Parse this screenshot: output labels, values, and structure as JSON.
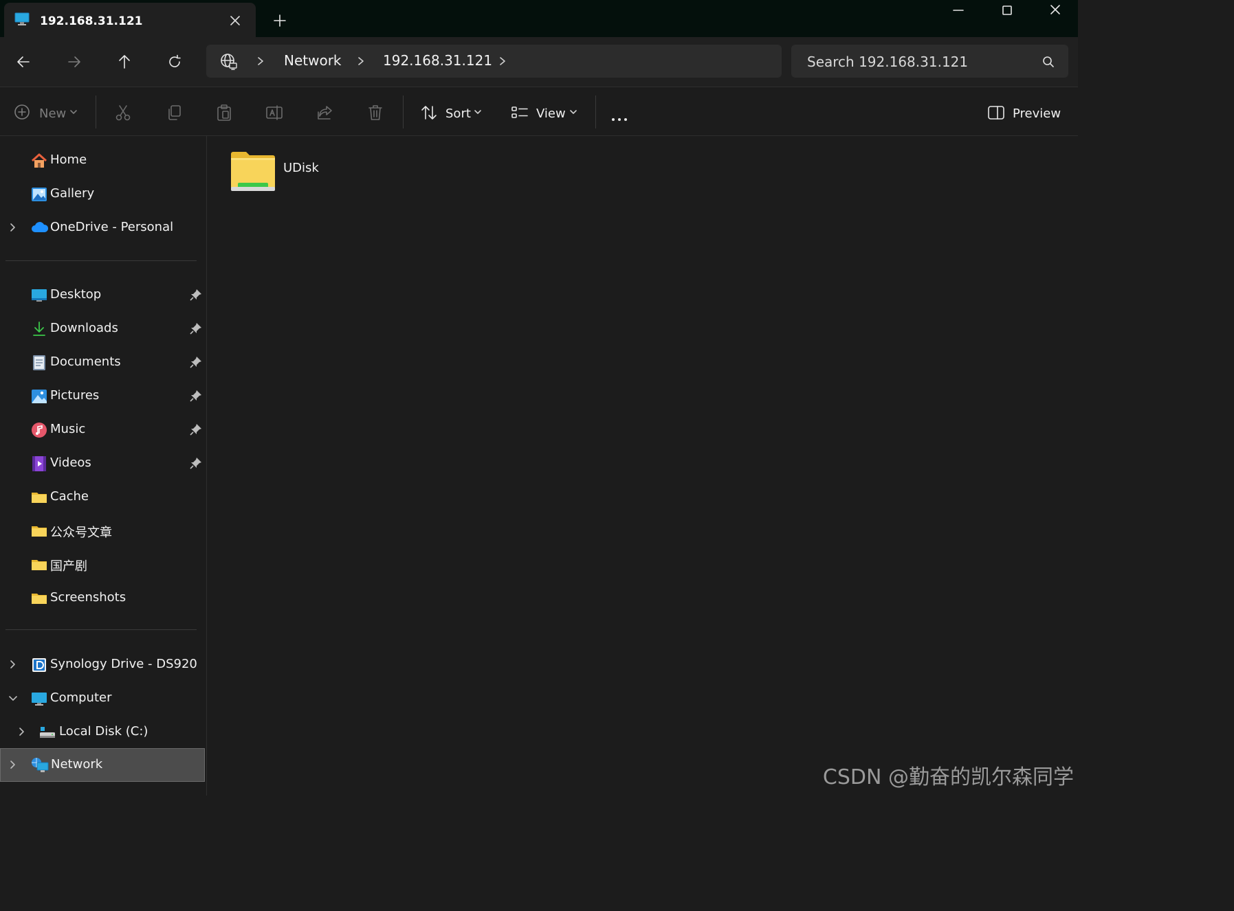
{
  "window": {
    "tab_title": "192.168.31.121",
    "new_tab_symbol": "+",
    "icons": [
      "computer-icon",
      "close-icon",
      "plus-icon",
      "minimize-icon",
      "maximize-icon",
      "close-window-icon"
    ]
  },
  "address_bar": {
    "breadcrumbs": [
      "Network",
      "192.168.31.121"
    ],
    "search_placeholder": "Search 192.168.31.121"
  },
  "toolbar": {
    "new_label": "New",
    "sort_label": "Sort",
    "view_label": "View",
    "preview_label": "Preview",
    "disabled_actions": [
      "cut-icon",
      "copy-icon",
      "paste-icon",
      "rename-icon",
      "share-icon",
      "delete-icon"
    ]
  },
  "sidebar": {
    "top_items": [
      {
        "label": "Home",
        "icon": "home-icon"
      },
      {
        "label": "Gallery",
        "icon": "gallery-icon"
      },
      {
        "label": "OneDrive - Personal",
        "icon": "onedrive-icon",
        "expandable": true
      }
    ],
    "quick_access": [
      {
        "label": "Desktop",
        "icon": "desktop-icon",
        "pinned": true
      },
      {
        "label": "Downloads",
        "icon": "download-icon",
        "pinned": true
      },
      {
        "label": "Documents",
        "icon": "document-icon",
        "pinned": true
      },
      {
        "label": "Pictures",
        "icon": "pictures-icon",
        "pinned": true
      },
      {
        "label": "Music",
        "icon": "music-icon",
        "pinned": true
      },
      {
        "label": "Videos",
        "icon": "videos-icon",
        "pinned": true
      },
      {
        "label": "Cache",
        "icon": "folder-icon",
        "pinned": false
      },
      {
        "label": "公众号文章",
        "icon": "folder-icon",
        "pinned": false
      },
      {
        "label": "国产剧",
        "icon": "folder-icon",
        "pinned": false
      },
      {
        "label": "Screenshots",
        "icon": "folder-icon",
        "pinned": false
      }
    ],
    "locations": [
      {
        "label": "Synology Drive - DS920",
        "icon": "synology-icon",
        "expanded": false
      },
      {
        "label": "Computer",
        "icon": "computer-icon",
        "expanded": true
      },
      {
        "label": "Local Disk (C:)",
        "icon": "drive-icon",
        "expanded": false
      },
      {
        "label": "Network",
        "icon": "network-icon",
        "expanded": false,
        "selected": true
      }
    ]
  },
  "content": {
    "items": [
      {
        "name": "UDisk",
        "type": "network-folder"
      }
    ]
  },
  "watermark": "CSDN @勤奋的凯尔森同学",
  "colors": {
    "background": "#1c1c1c",
    "titlebar": "#04100c",
    "selected": "#4c4c4c",
    "folder_yellow": "#f8d45a",
    "accent_green": "#3cc84a"
  }
}
